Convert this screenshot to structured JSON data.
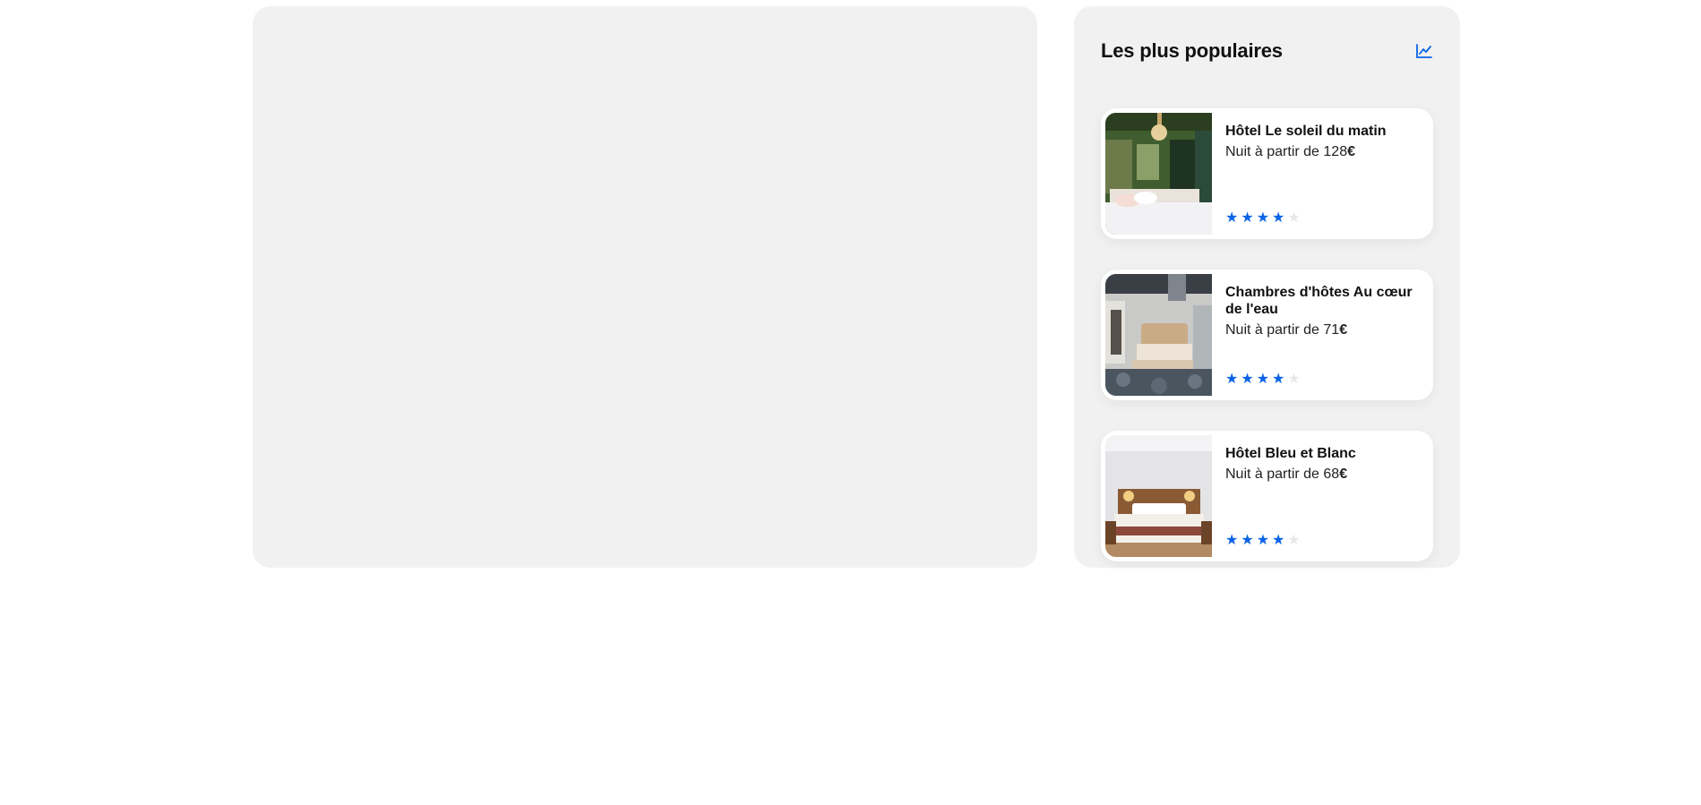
{
  "popular": {
    "title": "Les plus populaires",
    "icon": "trend-chart-icon",
    "accent_color": "#0a63e6",
    "hotels": [
      {
        "name": "Hôtel Le soleil du matin",
        "price_prefix": "Nuit à partir de ",
        "price": "128",
        "currency": "€",
        "rating": 4,
        "max_rating": 5,
        "image": "hotel-room-photo"
      },
      {
        "name": "Chambres d'hôtes Au cœur de l'eau",
        "price_prefix": "Nuit à partir de ",
        "price": "71",
        "currency": "€",
        "rating": 4,
        "max_rating": 5,
        "image": "hotel-room-photo"
      },
      {
        "name": "Hôtel Bleu et Blanc",
        "price_prefix": "Nuit à partir de ",
        "price": "68",
        "currency": "€",
        "rating": 4,
        "max_rating": 5,
        "image": "hotel-room-photo"
      }
    ]
  }
}
